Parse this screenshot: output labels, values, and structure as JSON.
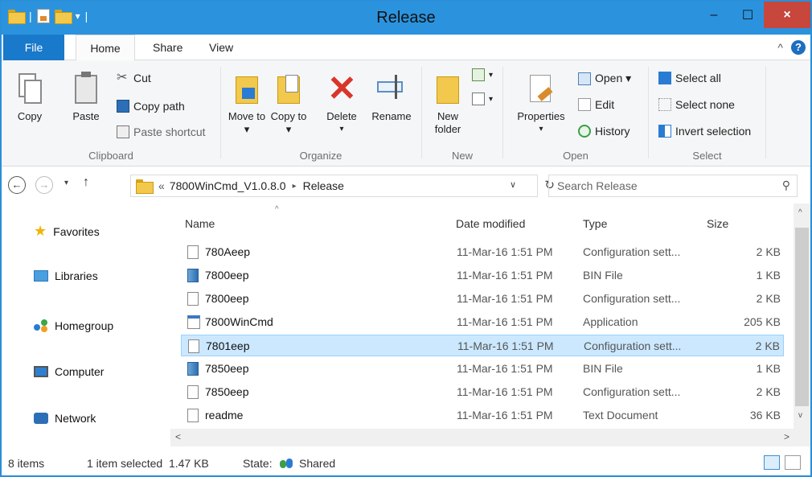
{
  "window": {
    "title": "Release"
  },
  "window_buttons": {
    "minimize": "–",
    "maximize": "☐",
    "close": "×"
  },
  "tabs": [
    {
      "label": "File"
    },
    {
      "label": "Home"
    },
    {
      "label": "Share"
    },
    {
      "label": "View"
    }
  ],
  "ribbon": {
    "clipboard": {
      "label": "Clipboard",
      "copy": "Copy",
      "paste": "Paste",
      "cut": "Cut",
      "copy_path": "Copy path",
      "paste_shortcut": "Paste shortcut"
    },
    "organize": {
      "label": "Organize",
      "move_to": "Move to ▾",
      "copy_to": "Copy to ▾",
      "delete": "Delete",
      "rename": "Rename"
    },
    "new": {
      "label": "New",
      "new_folder": "New folder"
    },
    "open": {
      "label": "Open",
      "properties": "Properties",
      "open": "Open ▾",
      "edit": "Edit",
      "history": "History"
    },
    "select": {
      "label": "Select",
      "select_all": "Select all",
      "select_none": "Select none",
      "invert_selection": "Invert selection"
    }
  },
  "address": {
    "prefix": "«",
    "path": [
      "7800WinCmd_V1.0.8.0",
      "Release"
    ],
    "separator": "▸"
  },
  "search": {
    "placeholder": "Search Release"
  },
  "nav": [
    {
      "label": "Favorites",
      "icon": "star-icon"
    },
    {
      "label": "Libraries",
      "icon": "libraries-icon"
    },
    {
      "label": "Homegroup",
      "icon": "homegroup-icon"
    },
    {
      "label": "Computer",
      "icon": "computer-icon"
    },
    {
      "label": "Network",
      "icon": "network-icon"
    }
  ],
  "columns": {
    "name": "Name",
    "date": "Date modified",
    "type": "Type",
    "size": "Size"
  },
  "files": [
    {
      "name": "780Aeep",
      "date": "11-Mar-16 1:51 PM",
      "type": "Configuration sett...",
      "size": "2 KB",
      "icon": "config-file-icon",
      "selected": false
    },
    {
      "name": "7800eep",
      "date": "11-Mar-16 1:51 PM",
      "type": "BIN File",
      "size": "1 KB",
      "icon": "bin-file-icon",
      "selected": false
    },
    {
      "name": "7800eep",
      "date": "11-Mar-16 1:51 PM",
      "type": "Configuration sett...",
      "size": "2 KB",
      "icon": "config-file-icon",
      "selected": false
    },
    {
      "name": "7800WinCmd",
      "date": "11-Mar-16 1:51 PM",
      "type": "Application",
      "size": "205 KB",
      "icon": "application-icon",
      "selected": false
    },
    {
      "name": "7801eep",
      "date": "11-Mar-16 1:51 PM",
      "type": "Configuration sett...",
      "size": "2 KB",
      "icon": "config-file-icon",
      "selected": true
    },
    {
      "name": "7850eep",
      "date": "11-Mar-16 1:51 PM",
      "type": "BIN File",
      "size": "1 KB",
      "icon": "bin-file-icon",
      "selected": false
    },
    {
      "name": "7850eep",
      "date": "11-Mar-16 1:51 PM",
      "type": "Configuration sett...",
      "size": "2 KB",
      "icon": "config-file-icon",
      "selected": false
    },
    {
      "name": "readme",
      "date": "11-Mar-16 1:51 PM",
      "type": "Text Document",
      "size": "36 KB",
      "icon": "text-file-icon",
      "selected": false
    }
  ],
  "status": {
    "items": "8 items",
    "selected": "1 item selected  1.47 KB",
    "state_label": "State:",
    "state_value": "Shared"
  },
  "colors": {
    "titlebar": "#2b93de",
    "file_tab": "#1979ca",
    "selection": "#cce8ff",
    "close_button": "#c7473c"
  }
}
